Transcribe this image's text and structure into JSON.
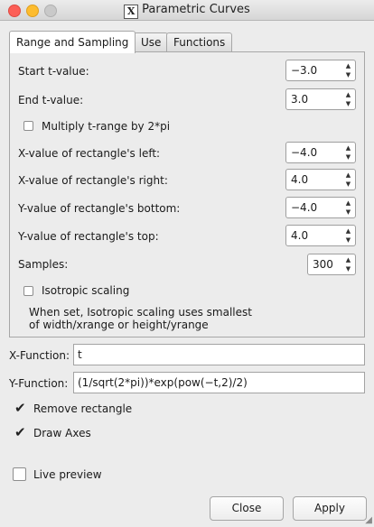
{
  "window": {
    "title": "Parametric Curves",
    "logo": "X"
  },
  "tabs": [
    {
      "label": "Range and Sampling",
      "active": true
    },
    {
      "label": "Use",
      "active": false
    },
    {
      "label": "Functions",
      "active": false
    }
  ],
  "range": {
    "start": {
      "label": "Start t-value:",
      "value": "−3.0"
    },
    "end": {
      "label": "End t-value:",
      "value": "3.0"
    },
    "multiply": {
      "label": "Multiply t-range by 2*pi",
      "checked": false
    },
    "xleft": {
      "label": "X-value of rectangle's left:",
      "value": "−4.0"
    },
    "xright": {
      "label": "X-value of rectangle's right:",
      "value": "4.0"
    },
    "ybottom": {
      "label": "Y-value of rectangle's bottom:",
      "value": "−4.0"
    },
    "ytop": {
      "label": "Y-value of rectangle's top:",
      "value": "4.0"
    },
    "samples": {
      "label": "Samples:",
      "value": "300"
    },
    "isotropic": {
      "label": "Isotropic scaling",
      "checked": false
    },
    "note_line1": "When set, Isotropic scaling uses smallest",
    "note_line2": "of width/xrange or height/yrange"
  },
  "functions": {
    "x_label": "X-Function:",
    "x_value": "t",
    "y_label": "Y-Function:",
    "y_value": "(1/sqrt(2*pi))*exp(pow(−t,2)/2)"
  },
  "options": {
    "remove_rectangle": {
      "label": "Remove rectangle",
      "checked": true
    },
    "draw_axes": {
      "label": "Draw Axes",
      "checked": true
    },
    "live_preview": {
      "label": "Live preview",
      "checked": false
    }
  },
  "buttons": {
    "close": "Close",
    "apply": "Apply"
  }
}
